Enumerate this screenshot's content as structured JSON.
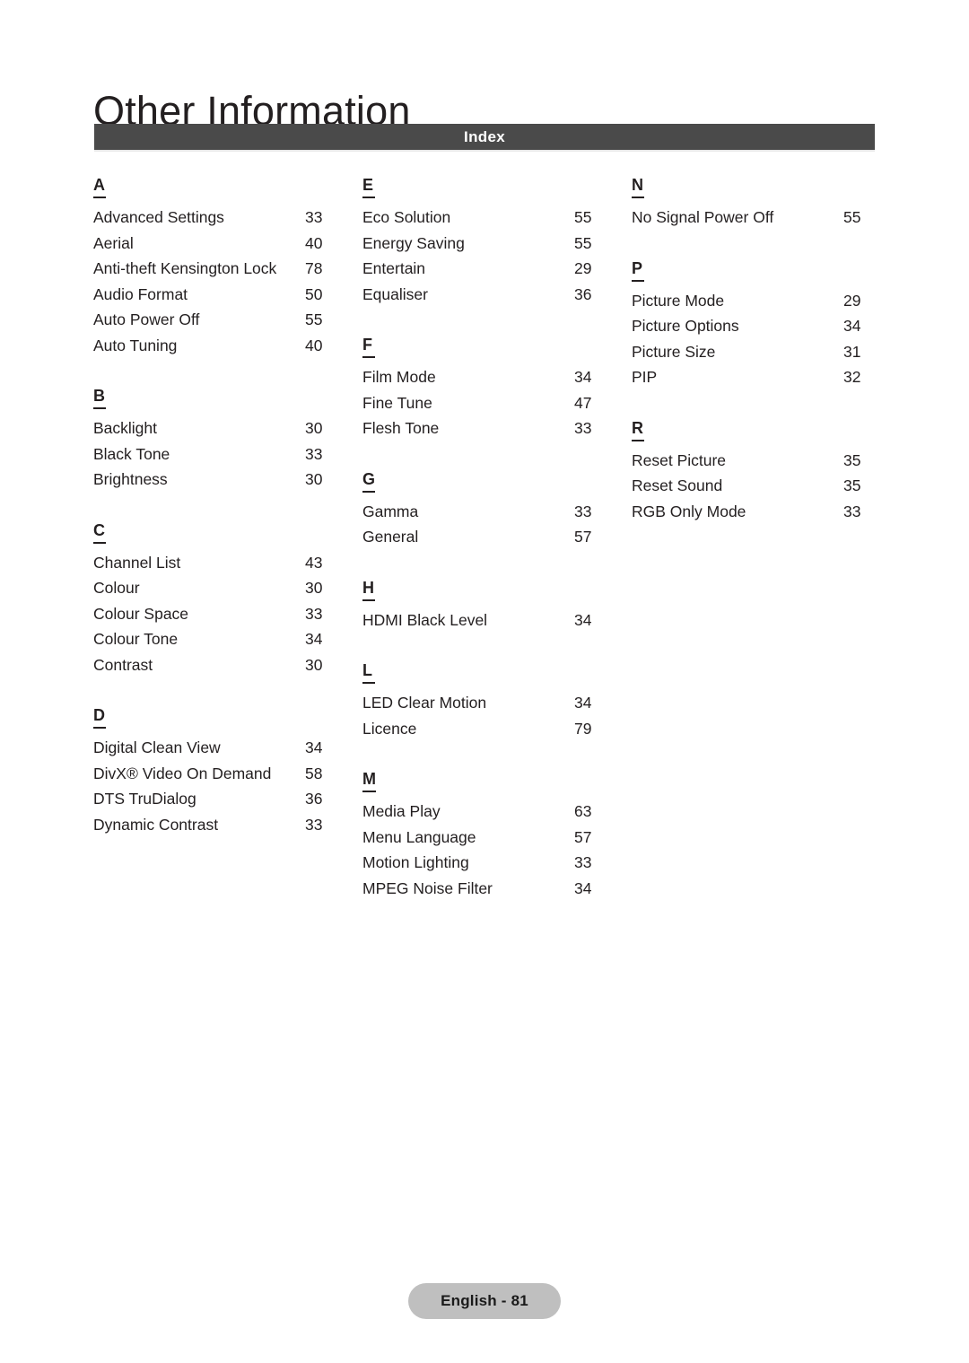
{
  "document": {
    "chapter_title": "Other Information",
    "section_bar_title": "Index",
    "footer_label": "English - 81",
    "colors": {
      "section_bar_background": "#4a4a4a",
      "section_bar_text": "#ffffff",
      "body_text": "#231f20",
      "footer_pill_background": "#bfbfbf",
      "page_background": "#ffffff"
    }
  },
  "index": {
    "columns": [
      {
        "groups": [
          {
            "letter": "A",
            "entries": [
              {
                "name": "Advanced Settings",
                "page": "33"
              },
              {
                "name": "Aerial",
                "page": "40"
              },
              {
                "name": "Anti-theft Kensington Lock",
                "page": "78"
              },
              {
                "name": "Audio Format",
                "page": "50"
              },
              {
                "name": "Auto Power Off",
                "page": "55"
              },
              {
                "name": "Auto Tuning",
                "page": "40"
              }
            ]
          },
          {
            "letter": "B",
            "entries": [
              {
                "name": "Backlight",
                "page": "30"
              },
              {
                "name": "Black Tone",
                "page": "33"
              },
              {
                "name": "Brightness",
                "page": "30"
              }
            ]
          },
          {
            "letter": "C",
            "entries": [
              {
                "name": "Channel List",
                "page": "43"
              },
              {
                "name": "Colour",
                "page": "30"
              },
              {
                "name": "Colour Space",
                "page": "33"
              },
              {
                "name": "Colour Tone",
                "page": "34"
              },
              {
                "name": "Contrast",
                "page": "30"
              }
            ]
          },
          {
            "letter": "D",
            "entries": [
              {
                "name": "Digital Clean View",
                "page": "34"
              },
              {
                "name": "DivX® Video On Demand",
                "page": "58"
              },
              {
                "name": "DTS TruDialog",
                "page": "36"
              },
              {
                "name": "Dynamic Contrast",
                "page": "33"
              }
            ]
          }
        ]
      },
      {
        "groups": [
          {
            "letter": "E",
            "entries": [
              {
                "name": "Eco Solution",
                "page": "55"
              },
              {
                "name": "Energy Saving",
                "page": "55"
              },
              {
                "name": "Entertain",
                "page": "29"
              },
              {
                "name": "Equaliser",
                "page": "36"
              }
            ]
          },
          {
            "letter": "F",
            "entries": [
              {
                "name": "Film Mode",
                "page": "34"
              },
              {
                "name": "Fine Tune",
                "page": "47"
              },
              {
                "name": "Flesh Tone",
                "page": "33"
              }
            ]
          },
          {
            "letter": "G",
            "entries": [
              {
                "name": "Gamma",
                "page": "33"
              },
              {
                "name": "General",
                "page": "57"
              }
            ]
          },
          {
            "letter": "H",
            "entries": [
              {
                "name": "HDMI Black Level",
                "page": "34"
              }
            ]
          },
          {
            "letter": "L",
            "entries": [
              {
                "name": "LED Clear Motion",
                "page": "34"
              },
              {
                "name": "Licence",
                "page": "79"
              }
            ]
          },
          {
            "letter": "M",
            "entries": [
              {
                "name": "Media Play",
                "page": "63"
              },
              {
                "name": "Menu Language",
                "page": "57"
              },
              {
                "name": "Motion Lighting",
                "page": "33"
              },
              {
                "name": "MPEG Noise Filter",
                "page": "34"
              }
            ]
          }
        ]
      },
      {
        "groups": [
          {
            "letter": "N",
            "entries": [
              {
                "name": "No Signal Power Off",
                "page": "55"
              }
            ]
          },
          {
            "letter": "P",
            "entries": [
              {
                "name": "Picture Mode",
                "page": "29"
              },
              {
                "name": "Picture Options",
                "page": "34"
              },
              {
                "name": "Picture Size",
                "page": "31"
              },
              {
                "name": "PIP",
                "page": "32"
              }
            ]
          },
          {
            "letter": "R",
            "entries": [
              {
                "name": "Reset Picture",
                "page": "35"
              },
              {
                "name": "Reset Sound",
                "page": "35"
              },
              {
                "name": "RGB Only Mode",
                "page": "33"
              }
            ]
          }
        ]
      }
    ]
  }
}
